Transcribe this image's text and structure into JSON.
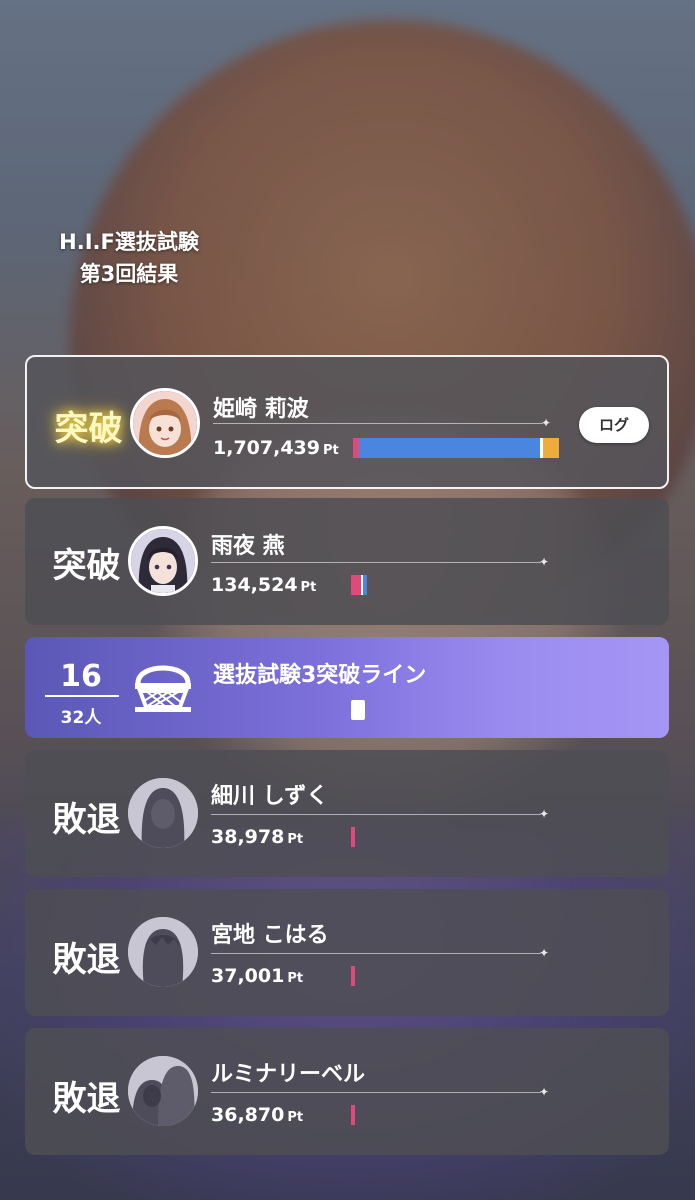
{
  "header": {
    "title_line1": "H.I.F選抜試験",
    "title_line2": "第3回結果"
  },
  "colors": {
    "bar_pink": "#e04a7a",
    "bar_blue": "#4a86e0",
    "bar_gold": "#f0ac3a",
    "status_gold": "#fff8c0"
  },
  "entries": [
    {
      "status": "突破",
      "name": "姫崎 莉波",
      "points": "1,707,439",
      "unit": "Pt",
      "log_label": "ログ",
      "icon": "character-portrait"
    },
    {
      "status": "突破",
      "name": "雨夜 燕",
      "points": "134,524",
      "unit": "Pt",
      "icon": "character-portrait"
    },
    {
      "status": "敗退",
      "name": "細川 しずく",
      "points": "38,978",
      "unit": "Pt",
      "icon": "silhouette-avatar"
    },
    {
      "status": "敗退",
      "name": "宮地 こはる",
      "points": "37,001",
      "unit": "Pt",
      "icon": "silhouette-avatar"
    },
    {
      "status": "敗退",
      "name": "ルミナリーベル",
      "points": "36,870",
      "unit": "Pt",
      "icon": "silhouette-avatar"
    }
  ],
  "cutline": {
    "rank": "16",
    "total": "32人",
    "label": "選抜試験3突破ライン",
    "icon": "gate-icon"
  }
}
